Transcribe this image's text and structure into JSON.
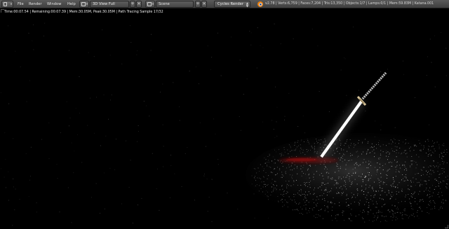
{
  "header": {
    "menus": [
      "File",
      "Render",
      "Window",
      "Help"
    ],
    "screen_layout": "3D View Full",
    "scene": "Scene",
    "render_engine": "Cycles Render",
    "stats": "v2.78 | Verts:6,759 | Faces:7,204 | Tris:13,350 | Objects:1/7 | Lamps:0/1 | Mem:59.83M | Katana.001"
  },
  "viewport": {
    "render_info": "Time:00:07.54 | Remaining:00:07.39 | Mem:30.05M, Peak:30.05M | Path Tracing Sample 17/32"
  },
  "colors": {
    "header_bg": "#4a4a4a",
    "viewport_bg": "#000000",
    "blade_glow": "#ffffff",
    "blood": "#6a0a0a",
    "logo_orange": "#e87d0d"
  },
  "icons": [
    "info-editor-icon",
    "screen-layout-icon",
    "scene-icon",
    "blender-logo-icon"
  ]
}
